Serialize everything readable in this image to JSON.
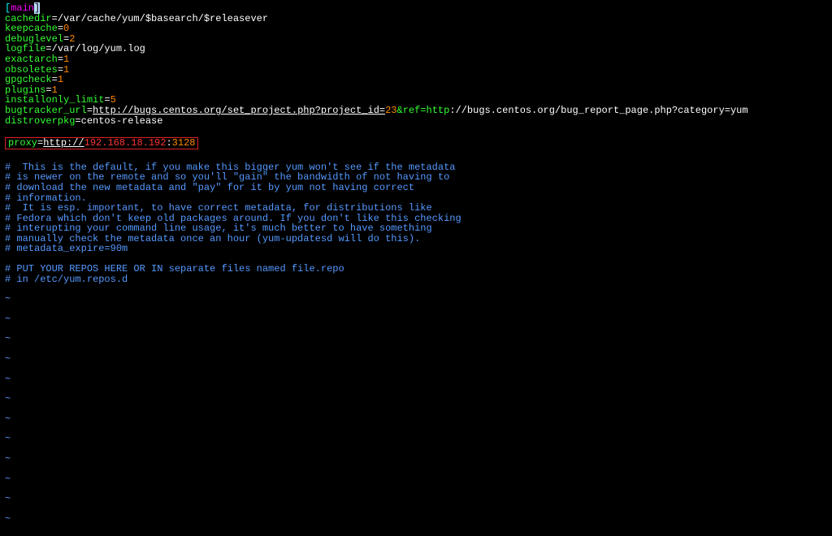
{
  "section": {
    "open_bracket": "[",
    "name": "main",
    "close_bracket": "]"
  },
  "conf": {
    "cachedir_key": "cachedir",
    "cachedir_val": "=/var/cache/yum/$basearch/$releasever",
    "keepcache_key": "keepcache",
    "keepcache_eq": "=",
    "keepcache_val": "0",
    "debuglevel_key": "debuglevel",
    "debuglevel_eq": "=",
    "debuglevel_val": "2",
    "logfile_key": "logfile",
    "logfile_val": "=/var/log/yum.log",
    "exactarch_key": "exactarch",
    "exactarch_eq": "=",
    "exactarch_val": "1",
    "obsoletes_key": "obsoletes",
    "obsoletes_eq": "=",
    "obsoletes_val": "1",
    "gpgcheck_key": "gpgcheck",
    "gpgcheck_eq": "=",
    "gpgcheck_val": "1",
    "plugins_key": "plugins",
    "plugins_eq": "=",
    "plugins_val": "1",
    "installonly_key": "installonly_limit",
    "installonly_eq": "=",
    "installonly_val": "5",
    "bugtracker_key": "bugtracker_url",
    "bugtracker_eq": "=",
    "bugtracker_url1": "http://bugs.centos.org/set_project.php?project_id=",
    "bugtracker_23": "23",
    "bugtracker_amp": "&ref=http",
    "bugtracker_url2": "://bugs.centos.org/bug_report_page.php?category=yum",
    "distroverpkg_key": "distroverpkg",
    "distroverpkg_val": "=centos-release"
  },
  "proxy": {
    "key": "proxy",
    "eq": "=",
    "scheme": "http://",
    "ip": "192.168.18.192",
    "colon": ":",
    "port": "3128"
  },
  "comments": {
    "c1": "#  This is the default, if you make this bigger yum won't see if the metadata",
    "c2": "# is newer on the remote and so you'll \"gain\" the bandwidth of not having to",
    "c3": "# download the new metadata and \"pay\" for it by yum not having correct",
    "c4": "# information.",
    "c5": "#  It is esp. important, to have correct metadata, for distributions like",
    "c6": "# Fedora which don't keep old packages around. If you don't like this checking",
    "c7": "# interupting your command line usage, it's much better to have something",
    "c8": "# manually check the metadata once an hour (yum-updatesd will do this).",
    "c9": "# metadata_expire=90m",
    "c10": "# PUT YOUR REPOS HERE OR IN separate files named file.repo",
    "c11": "# in /etc/yum.repos.d"
  },
  "tilde": "~"
}
